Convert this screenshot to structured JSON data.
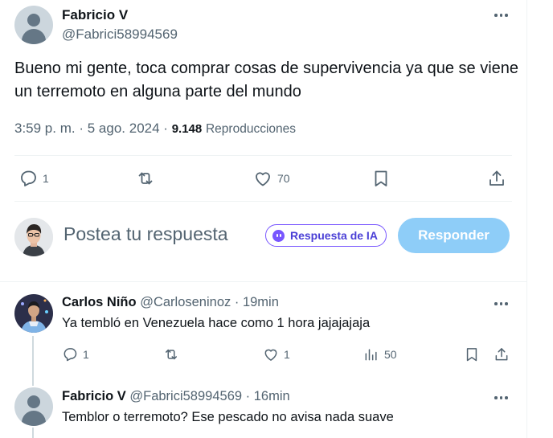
{
  "main_tweet": {
    "display_name": "Fabricio V",
    "handle": "@Fabrici58994569",
    "text": "Bueno mi gente, toca comprar cosas de supervivencia ya que se viene un terremoto en alguna parte del mundo",
    "time": "3:59 p. m.",
    "date": "5 ago. 2024",
    "separator": "·",
    "views": "9.148",
    "views_label": "Reproducciones",
    "actions": {
      "replies": "1",
      "retweets": "",
      "likes": "70"
    }
  },
  "composer": {
    "placeholder": "Postea tu respuesta",
    "ia_label": "Respuesta de IA",
    "reply_button": "Responder"
  },
  "replies": [
    {
      "display_name": "Carlos Niño",
      "handle": "@Carloseninoz",
      "separator": "·",
      "time": "19min",
      "text": "Ya tembló en Venezuela hace como 1 hora jajajajaja",
      "actions": {
        "replies": "1",
        "retweets": "",
        "likes": "1",
        "views": "50"
      }
    },
    {
      "display_name": "Fabricio V",
      "handle": "@Fabrici58994569",
      "separator": "·",
      "time": "16min",
      "text": "Temblor o terremoto? Ese pescado no avisa nada suave"
    }
  ],
  "colors": {
    "text": "#0f1419",
    "muted": "#536471",
    "reply_button": "#8ecdf8",
    "ia_accent": "#7856ff",
    "divider": "#eff3f4"
  },
  "icons": [
    "more-icon",
    "reply-icon",
    "retweet-icon",
    "like-icon",
    "bookmark-icon",
    "share-icon",
    "views-icon",
    "ia-icon"
  ]
}
